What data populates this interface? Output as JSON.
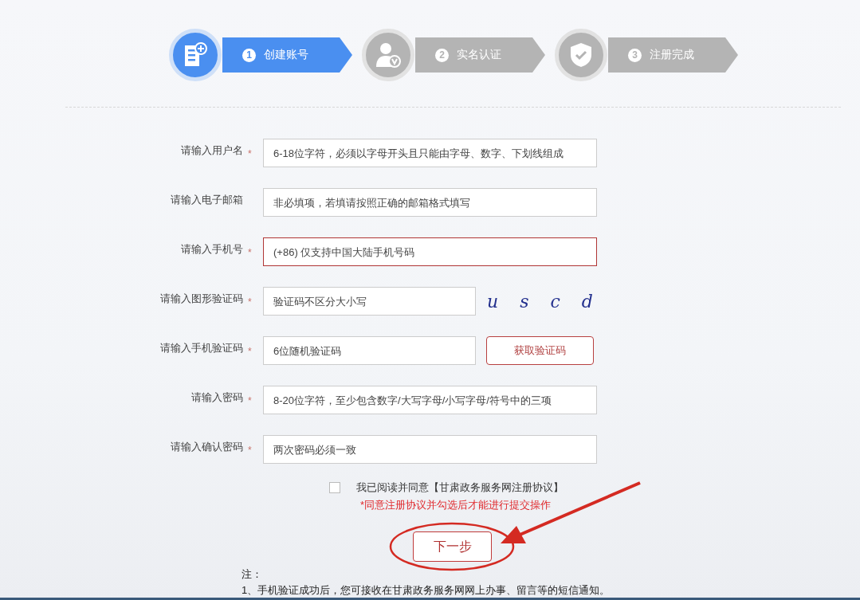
{
  "steps": [
    {
      "number": "1",
      "label": "创建账号",
      "selected": true
    },
    {
      "number": "2",
      "label": "实名认证",
      "selected": false
    },
    {
      "number": "3",
      "label": "注册完成",
      "selected": false
    }
  ],
  "fields": [
    {
      "kind": "text",
      "label": "请输入用户名",
      "required": true,
      "placeholder": "6-18位字符，必须以字母开头且只能由字母、数字、下划线组成",
      "error": false
    },
    {
      "kind": "text",
      "label": "请输入电子邮箱",
      "required": false,
      "placeholder": "非必填项，若填请按照正确的邮箱格式填写",
      "error": false
    },
    {
      "kind": "text",
      "label": "请输入手机号",
      "required": true,
      "placeholder": "(+86) 仅支持中国大陆手机号码",
      "error": true
    },
    {
      "kind": "captcha",
      "label": "请输入图形验证码",
      "required": true,
      "placeholder": "验证码不区分大小写",
      "error": false,
      "captcha": "u s c d"
    },
    {
      "kind": "sms",
      "label": "请输入手机验证码",
      "required": true,
      "placeholder": "6位随机验证码",
      "error": false,
      "button": "获取验证码"
    },
    {
      "kind": "text",
      "label": "请输入密码",
      "required": true,
      "placeholder": "8-20位字符，至少包含数字/大写字母/小写字母/符号中的三项",
      "error": false
    },
    {
      "kind": "text",
      "label": "请输入确认密码",
      "required": true,
      "placeholder": "两次密码必须一致",
      "error": false
    }
  ],
  "required_mark": "*",
  "agreement": {
    "checked": false,
    "label": "我已阅读并同意【甘肃政务服务网注册协议】",
    "hint": "*同意注册协议并勾选后才能进行提交操作"
  },
  "next_button": "下一步",
  "notes": {
    "title": "注：",
    "items": [
      "1、手机验证成功后，您可接收在甘肃政务服务网网上办事、留言等的短信通知。"
    ]
  }
}
